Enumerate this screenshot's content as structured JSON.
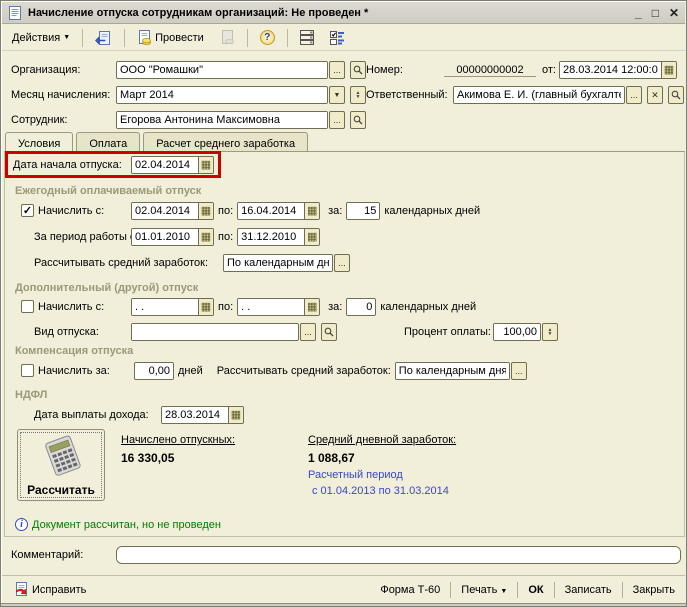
{
  "window": {
    "title": "Начисление отпуска сотрудникам организаций: Не проведен *"
  },
  "toolbar": {
    "actions_label": "Действия",
    "post_label": "Провести"
  },
  "header": {
    "org_label": "Организация:",
    "org_value": "ООО \"Ромашки\"",
    "month_label": "Месяц начисления:",
    "month_value": "Март 2014",
    "employee_label": "Сотрудник:",
    "employee_value": "Егорова Антонина Максимовна",
    "number_label": "Номер:",
    "number_value": "00000000002",
    "date_label": "от:",
    "date_value": "28.03.2014 12:00:01",
    "responsible_label": "Ответственный:",
    "responsible_value": "Акимова Е. И. (главный бухгалте"
  },
  "tabs": {
    "t1": "Условия",
    "t2": "Оплата",
    "t3": "Расчет среднего заработка"
  },
  "conditions": {
    "start_date_label": "Дата начала отпуска:",
    "start_date_value": "02.04.2014",
    "annual": {
      "title": "Ежегодный оплачиваемый отпуск",
      "accrue_label": "Начислить с:",
      "accrue_checked": true,
      "check_glyph": "✓",
      "from": "02.04.2014",
      "to_label": "по:",
      "to": "16.04.2014",
      "for_label": "за:",
      "days": "15",
      "days_suffix": "календарных дней",
      "period_label": "За период работы с:",
      "period_from": "01.01.2010",
      "period_to": "31.12.2010",
      "avg_label": "Рассчитывать средний заработок:",
      "avg_value": "По календарным дня"
    },
    "additional": {
      "title": "Дополнительный (другой) отпуск",
      "accrue_label": "Начислить с:",
      "accrue_checked": false,
      "from": ". .",
      "to_label": "по:",
      "to": ". .",
      "for_label": "за:",
      "days": "0",
      "days_suffix": "календарных дней",
      "type_label": "Вид отпуска:",
      "type_value": "",
      "percent_label": "Процент оплаты:",
      "percent_value": "100,00"
    },
    "compensation": {
      "title": "Компенсация отпуска",
      "accrue_label": "Начислить за:",
      "accrue_checked": false,
      "days": "0,00",
      "days_suffix": "дней",
      "avg_label": "Рассчитывать средний заработок:",
      "avg_value": "По календарным дням"
    },
    "ndfl": {
      "title": "НДФЛ",
      "pay_date_label": "Дата выплаты дохода:",
      "pay_date": "28.03.2014"
    },
    "calc_button_label": "Рассчитать",
    "accrued_label": "Начислено отпускных:",
    "accrued_value": "16 330,05",
    "avg_daily_label": "Средний дневной заработок:",
    "avg_daily_value": "1 088,67",
    "calc_period_label": "Расчетный период",
    "calc_period_value": "с 01.04.2013 по 31.03.2014"
  },
  "status": {
    "message": "Документ рассчитан, но не проведен"
  },
  "comment": {
    "label": "Комментарий:",
    "value": ""
  },
  "footer": {
    "fix_label": "Исправить",
    "form_t60": "Форма Т-60",
    "print": "Печать",
    "ok": "ОК",
    "save": "Записать",
    "close": "Закрыть"
  },
  "colors": {
    "form_bg": "#f1eeda",
    "highlight_red": "#cc0000",
    "group_title": "#9a9a78",
    "status_green": "#008000",
    "link_blue": "#3a47c5",
    "field_border": "#6e6e52"
  }
}
